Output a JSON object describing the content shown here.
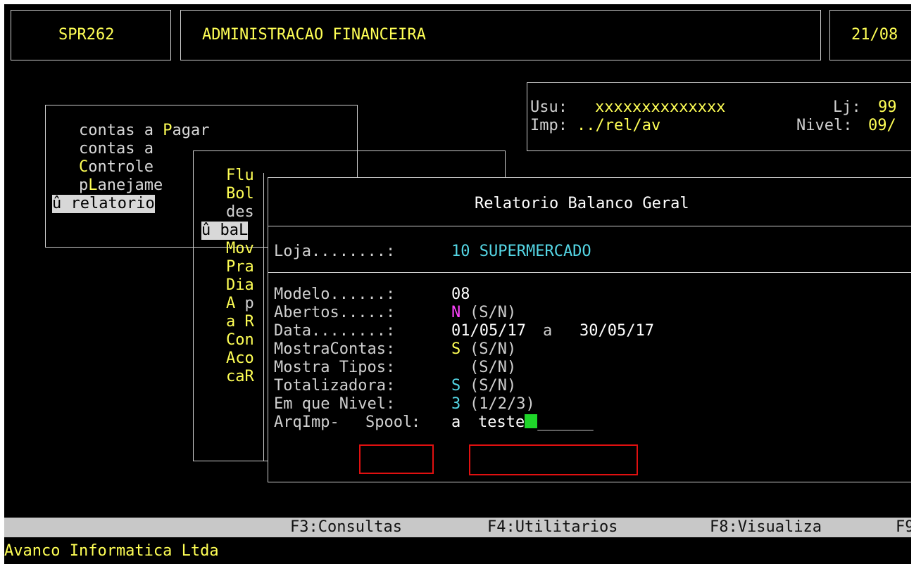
{
  "header": {
    "program_code": "SPR262",
    "system_title": "ADMINISTRACAO FINANCEIRA",
    "date_partial": "21/08"
  },
  "session": {
    "usu_label": "Usu:",
    "usu_value": "xxxxxxxxxxxxxx",
    "lj_label": "Lj:",
    "lj_value": "99",
    "imp_label": "Imp:",
    "imp_value": "../rel/av",
    "nivel_label": "Nivel:",
    "nivel_value": "09/"
  },
  "main_menu": {
    "items": [
      {
        "pre": "contas a ",
        "hot": "P",
        "post": "agar",
        "selected": false
      },
      {
        "pre": "contas a ",
        "hot": "",
        "post": "",
        "selected": false
      },
      {
        "pre": "",
        "hot": "C",
        "post": "ontrole",
        "selected": false
      },
      {
        "pre": "p",
        "hot": "L",
        "post": "anejame",
        "selected": false
      },
      {
        "pre": "û relatorio",
        "hot": "",
        "post": "",
        "selected": true
      }
    ]
  },
  "sub_menu": {
    "items": [
      {
        "hot": "Flu",
        "rest": ""
      },
      {
        "hot": "Bol",
        "rest": ""
      },
      {
        "hot": "",
        "rest": "des"
      },
      {
        "hot": "û baL",
        "rest": ""
      },
      {
        "hot": "Mov",
        "rest": ""
      },
      {
        "hot": "Pra",
        "rest": ""
      },
      {
        "hot": "Dia",
        "rest": ""
      },
      {
        "hot": "A",
        "rest": " p"
      },
      {
        "hot": "a R",
        "rest": ""
      },
      {
        "hot": "Con",
        "rest": ""
      },
      {
        "hot": "Aco",
        "rest": ""
      },
      {
        "hot": "caR",
        "rest": ""
      }
    ]
  },
  "dialog": {
    "title": "Relatorio Balanco Geral",
    "loja_label": "Loja........:",
    "loja_value": "10 SUPERMERCADO",
    "fields": {
      "modelo": {
        "label": "Modelo......:",
        "value": "08",
        "hint": ""
      },
      "abertos": {
        "label": "Abertos.....:",
        "value": "N",
        "hint": "(S/N)"
      },
      "data": {
        "label": "Data........:",
        "value_from": "01/05/17",
        "sep": "a",
        "value_to": "30/05/17"
      },
      "mostra_contas": {
        "label": "MostraContas:",
        "value": "S",
        "hint": "(S/N)"
      },
      "mostra_tipos": {
        "label": "Mostra Tipos:",
        "value": "",
        "hint": "(S/N)"
      },
      "totalizadora": {
        "label": "Totalizadora:",
        "value": "S",
        "hint": "(S/N)"
      },
      "em_que_nivel": {
        "label": "Em que Nivel:",
        "value": "3",
        "hint": "(1/2/3)"
      },
      "arqimp": {
        "label_pre": "ArqImp-",
        "label_spool": "Spool",
        "label_colon": ":",
        "mode": "a",
        "value": "teste",
        "blank": "______"
      }
    }
  },
  "function_keys": {
    "f3": "F3:Consultas",
    "f4": "F4:Utilitarios",
    "f8": "F8:Visualiza",
    "f9": "F9"
  },
  "footer": {
    "company": "Avanco Informatica Ltda"
  },
  "colors": {
    "background": "#000000",
    "hotkey_yellow": "#ffff55",
    "value_cyan": "#55d7e6",
    "value_magenta": "#ff44ff",
    "cursor_green": "#1fd62a",
    "annotation_red": "#e01010",
    "function_bar": "#c8c8c8"
  }
}
